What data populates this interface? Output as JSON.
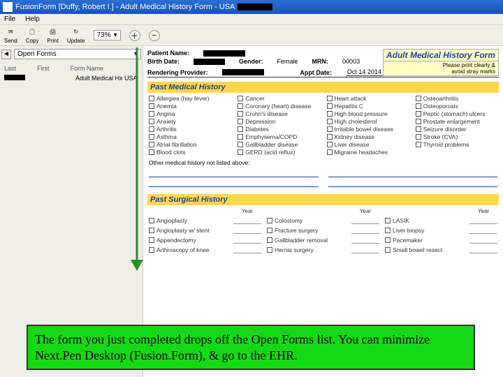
{
  "titlebar": {
    "app_title": "FusionForm [Duffy, Robert I.] - Adult Medical History Form - USA"
  },
  "menubar": {
    "items": [
      "File",
      "Help"
    ]
  },
  "toolbar": {
    "send": "Send",
    "copy": "Copy",
    "print": "Print",
    "update": "Update",
    "zoom_value": "73%"
  },
  "sidebar": {
    "open_forms_label": "Open Forms",
    "cols": {
      "last": "Last",
      "first": "First",
      "form": "Form Name"
    },
    "row": {
      "form_name": "Adult Medical Hx USA"
    }
  },
  "form": {
    "header": {
      "patient_name_label": "Patient Name:",
      "birth_label": "Birth Date:",
      "gender_label": "Gender:",
      "gender_value": "Female",
      "mrn_label": "MRN:",
      "mrn_value": "00003",
      "rendering_label": "Rendering Provider:",
      "appt_label": "Appt Date:",
      "appt_value": "Oct 14 2014",
      "title": "Adult Medical History Form",
      "hint1": "Please print clearly &",
      "hint2": "avoid stray marks"
    },
    "past_medical_title": "Past Medical History",
    "conditions": {
      "c0": [
        "Allergies (hay fever)",
        "Anemia",
        "Angina",
        "Anxiety",
        "Arthritis",
        "Asthma",
        "Atrial fibrillation",
        "Blood clots"
      ],
      "c1": [
        "Cancer",
        "Coronary (heart) disease",
        "Crohn's disease",
        "Depression",
        "Diabetes",
        "Emphysema/COPD",
        "Gallbladder disease",
        "GERD (acid reflux)"
      ],
      "c2": [
        "Heart attack",
        "Hepatitis C",
        "High blood pressure",
        "High cholesterol",
        "Irritable bowel disease",
        "Kidney disease",
        "Liver disease",
        "Migraine headaches"
      ],
      "c3": [
        "Osteoarthritis",
        "Osteoporosis",
        "Peptic (stomach) ulcers",
        "Prostate enlargement",
        "Seizure disorder",
        "Stroke (CVA)",
        "Thyroid problems",
        ""
      ]
    },
    "other_label": "Other medical history not listed above:",
    "past_surgical_title": "Past Surgical History",
    "year_label": "Year",
    "surgeries": {
      "s0": [
        "Angioplasty",
        "Angioplasty w/ stent",
        "Appendectomy",
        "Arthroscopy of knee"
      ],
      "s1": [
        "Colostomy",
        "Fracture surgery",
        "Gallbladder removal",
        "Hernia surgery"
      ],
      "s2": [
        "LASIK",
        "Liver biopsy",
        "Pacemaker",
        "Small bowel resect"
      ]
    }
  },
  "callout": {
    "text": "The form you just completed drops off the Open Forms list. You can minimize Next.Pen Desktop (Fusion.Form), & go to the EHR."
  }
}
